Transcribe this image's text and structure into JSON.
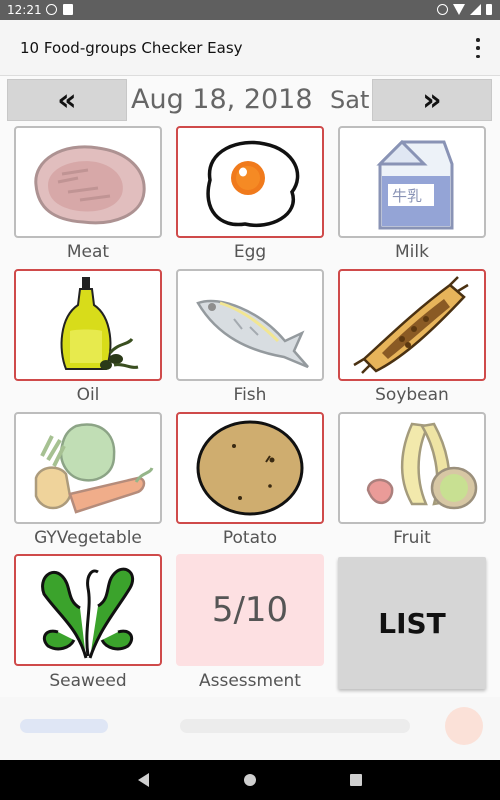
{
  "status": {
    "time": "12:21"
  },
  "app": {
    "title": "10 Food-groups Checker Easy",
    "menu_icon": "more-vert-icon"
  },
  "date": {
    "prev": "«",
    "next": "»",
    "text": "Aug 18, 2018",
    "weekday": "Sat"
  },
  "foods": [
    {
      "label": "Meat",
      "checked": false
    },
    {
      "label": "Egg",
      "checked": true
    },
    {
      "label": "Milk",
      "checked": false
    },
    {
      "label": "Oil",
      "checked": true
    },
    {
      "label": "Fish",
      "checked": false
    },
    {
      "label": "Soybean",
      "checked": true
    },
    {
      "label": "GYVegetable",
      "checked": false
    },
    {
      "label": "Potato",
      "checked": true
    },
    {
      "label": "Fruit",
      "checked": false
    },
    {
      "label": "Seaweed",
      "checked": true
    }
  ],
  "milk_text": "牛乳",
  "assessment": {
    "score": "5/10",
    "label": "Assessment"
  },
  "list_button": "LIST",
  "colors": {
    "checked_border": "#cf4a4a",
    "unchecked_border": "#bdbdbd",
    "assessment_bg": "#fde0e2"
  }
}
